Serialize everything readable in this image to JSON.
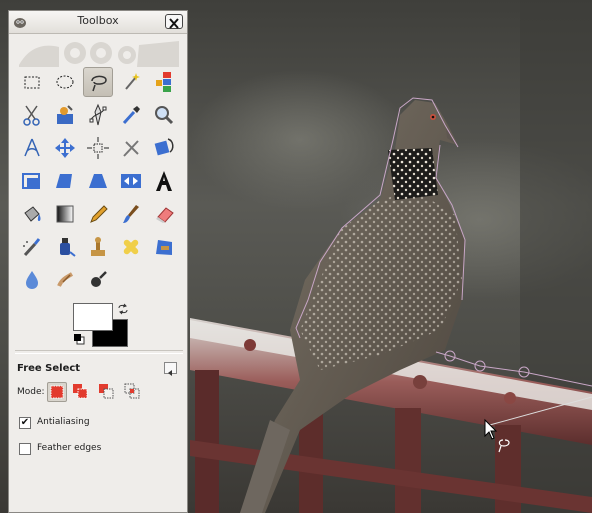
{
  "toolbox": {
    "title": "Toolbox",
    "tools": [
      "rect-select-icon",
      "ellipse-select-icon",
      "free-select-icon",
      "fuzzy-select-icon",
      "select-by-color-icon",
      "scissors-select-icon",
      "foreground-select-icon",
      "paths-icon",
      "color-picker-icon",
      "zoom-icon",
      "measure-icon",
      "move-icon",
      "align-icon",
      "crop-icon",
      "rotate-icon",
      "scale-icon",
      "shear-icon",
      "perspective-icon",
      "flip-icon",
      "text-tool-icon",
      "bucket-fill-icon",
      "blend-icon",
      "pencil-icon",
      "paintbrush-icon",
      "eraser-icon",
      "airbrush-icon",
      "ink-icon",
      "clone-icon",
      "heal-icon",
      "perspective-clone-icon",
      "blur-sharpen-icon",
      "smudge-icon",
      "dodge-burn-icon"
    ],
    "active_tool": "free-select-icon",
    "colors": {
      "foreground": "#ffffff",
      "background": "#000000"
    }
  },
  "tool_options": {
    "title": "Free Select",
    "mode_label": "Mode:",
    "modes": [
      "replace-mode-icon",
      "add-mode-icon",
      "subtract-mode-icon",
      "intersect-mode-icon"
    ],
    "active_mode": "replace-mode-icon",
    "antialiasing": {
      "label": "Antialiasing",
      "checked": true
    },
    "feather_edges": {
      "label": "Feather edges",
      "checked": false
    }
  },
  "canvas": {
    "subject": "dove-on-railing-photo",
    "selection": "free-select-path-in-progress"
  }
}
